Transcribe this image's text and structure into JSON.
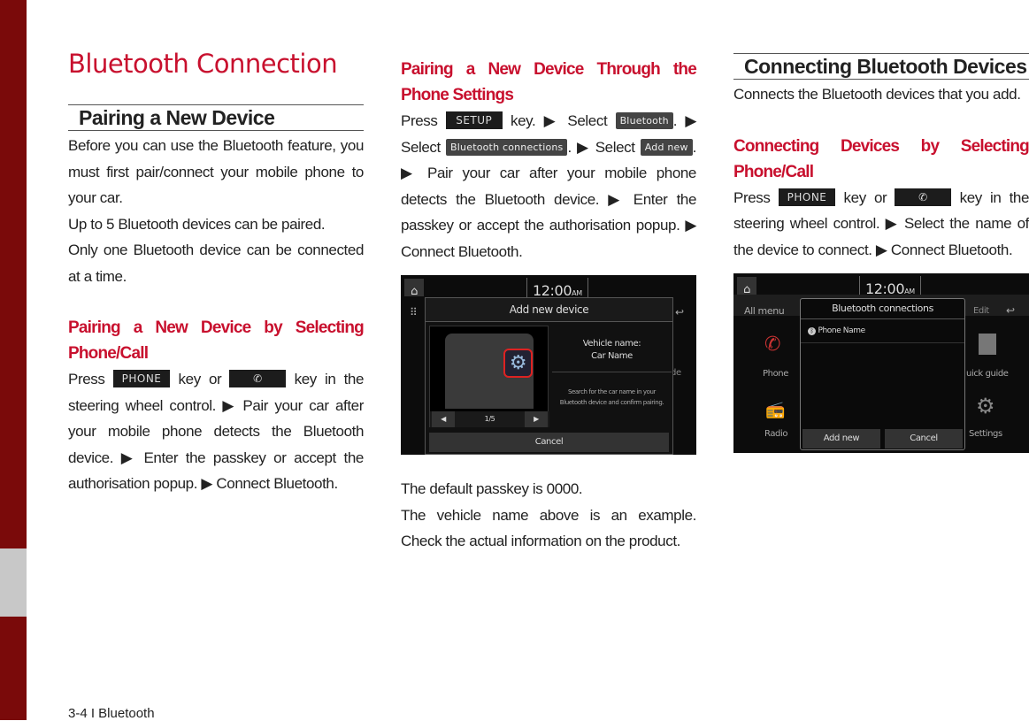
{
  "title": "Bluetooth Connection",
  "footer": "3-4 I Bluetooth",
  "col1": {
    "section": "Pairing a New Device",
    "p1": "Before you can use the Bluetooth feature, you must first pair/connect your mobile phone to your car.",
    "p2": "Up to 5 Bluetooth devices can be paired.",
    "p3": "Only one Bluetooth device can be connected at a time.",
    "sub": "Pairing a New Device by Selecting Phone/Call",
    "press": "Press",
    "key_phone": "PHONE",
    "key_or": "key or",
    "rest": "key in the steering wheel control. ▶ Pair your car after your mobile phone detects the Bluetooth device. ▶ Enter the passkey or accept the authorisation popup. ▶ Connect Bluetooth."
  },
  "col2": {
    "sub": "Pairing a New Device Through the Phone Settings",
    "press": "Press",
    "key_setup": "SETUP",
    "t1": "key. ▶ Select",
    "btn_bluetooth": "Bluetooth",
    "t2": ". ▶ Select",
    "btn_connections": "Bluetooth connections",
    "t3": ". ▶ Select",
    "btn_add": "Add new",
    "t4": ". ▶ Pair your car after your mobile phone detects the Bluetooth device. ▶ Enter the passkey or accept the authorisation popup. ▶ Connect Bluetooth.",
    "screen": {
      "time": "12:00",
      "ampm": "AM",
      "dialog_title": "Add new device",
      "vehicle_label": "Vehicle name:",
      "vehicle_name": "Car Name",
      "hint": "Search for the car name in your Bluetooth device and confirm pairing.",
      "page": "1/5",
      "cancel": "Cancel",
      "bg_text": "de"
    },
    "note1": "The default passkey is 0000.",
    "note2": "The vehicle name above is an example. Check the actual information on the product."
  },
  "col3": {
    "section": "Connecting Bluetooth Devices",
    "p1": "Connects the Bluetooth devices that you add.",
    "sub": "Connecting Devices by Selecting Phone/Call",
    "press": "Press",
    "key_phone": "PHONE",
    "key_or": "key or",
    "rest": "key in the steering wheel control. ▶ Select the name of the device to connect. ▶ Connect Bluetooth.",
    "screen": {
      "time": "12:00",
      "ampm": "AM",
      "all_menu": "All menu",
      "edit": "Edit",
      "dialog_title": "Bluetooth connections",
      "device": "Phone Name",
      "add_new": "Add new",
      "cancel": "Cancel",
      "phone": "Phone",
      "radio": "Radio",
      "quick_guide": "uick guide",
      "settings": "Settings"
    }
  },
  "colors": {
    "accent": "#c8102e",
    "sidebar": "#7a0a0a"
  }
}
